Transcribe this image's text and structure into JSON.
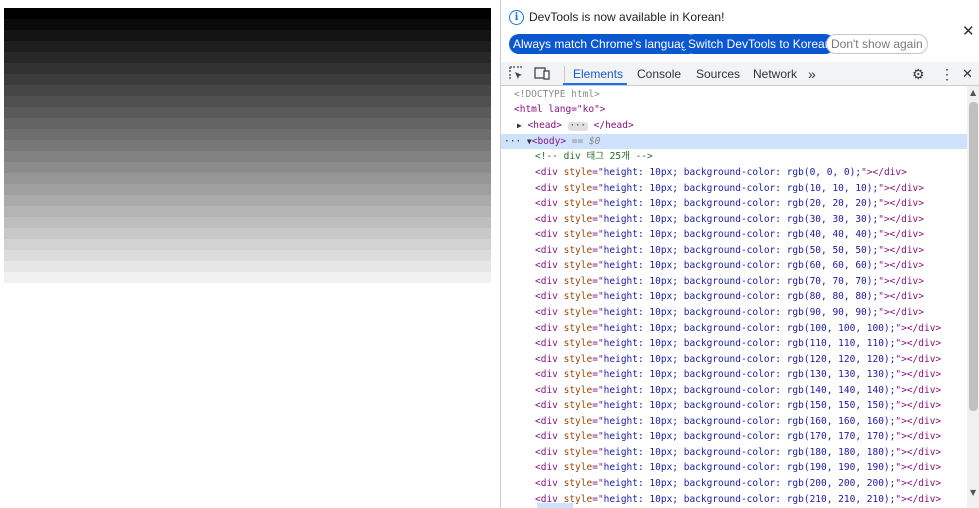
{
  "stripes": {
    "colors": [
      "#000000",
      "#0a0a0a",
      "#141414",
      "#1e1e1e",
      "#282828",
      "#323232",
      "#3c3c3c",
      "#464646",
      "#505050",
      "#5a5a5a",
      "#646464",
      "#6e6e6e",
      "#787878",
      "#828282",
      "#8c8c8c",
      "#969696",
      "#a0a0a0",
      "#aaaaaa",
      "#b4b4b4",
      "#bebebe",
      "#c8c8c8",
      "#d2d2d2",
      "#dcdcdc",
      "#e6e6e6",
      "#f0f0f0"
    ]
  },
  "infobar": {
    "icon": "info-icon",
    "message": "DevTools is now available in Korean!",
    "btn_match": "Always match Chrome's language",
    "btn_switch": "Switch DevTools to Korean",
    "btn_dont_show": "Don't show again",
    "close": "✕"
  },
  "tabbar": {
    "tabs": [
      "Elements",
      "Console",
      "Sources",
      "Network"
    ],
    "active": "Elements",
    "more": "»",
    "settings": "⚙",
    "menu": "⋮",
    "close": "✕"
  },
  "dom": {
    "doctype": "<!DOCTYPE html>",
    "html_open": "<html lang=\"ko\">",
    "head": "<head>",
    "head_dots": "···",
    "head_close": "</head>",
    "body": "<body>",
    "selected_marker": "== $0",
    "row_dots": "···",
    "comment": "<!-- div 태그 25개 -->",
    "div_prefix": "<div ",
    "div_attr": "style",
    "div_eq": "=\"",
    "div_value_prefix": "height: 10px; background-color: rgb(",
    "div_value_suffix": ");",
    "div_close": "\"></div>",
    "rgb_values": [
      0,
      10,
      20,
      30,
      40,
      50,
      60,
      70,
      80,
      90,
      100,
      110,
      120,
      130,
      140,
      150,
      160,
      170,
      180,
      190,
      200,
      210
    ]
  },
  "scrollbar": {
    "up": "▲",
    "down": "▼"
  }
}
